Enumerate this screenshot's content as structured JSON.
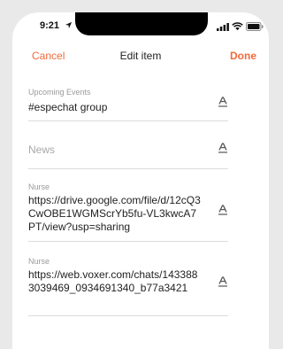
{
  "status_bar": {
    "time": "9:21"
  },
  "nav": {
    "cancel_label": "Cancel",
    "title": "Edit item",
    "done_label": "Done"
  },
  "fields": [
    {
      "label": "Upcoming Events",
      "value": "#espechat group",
      "icon": "text-format-icon"
    },
    {
      "label": "",
      "placeholder": "News",
      "icon": "text-format-icon"
    },
    {
      "label": "Nurse",
      "value": "https://drive.google.com/file/d/12cQ3CwOBE1WGMScrYb5fu-VL3kwcA7PT/view?usp=sharing",
      "icon": "text-format-icon"
    },
    {
      "label": "Nurse",
      "value": "https://web.voxer.com/chats/1433883039469_0934691340_b77a3421",
      "icon": "text-format-icon"
    }
  ],
  "colors": {
    "accent": "#f26a3a",
    "background": "#e9e9e9",
    "label": "#9a9a9a"
  }
}
